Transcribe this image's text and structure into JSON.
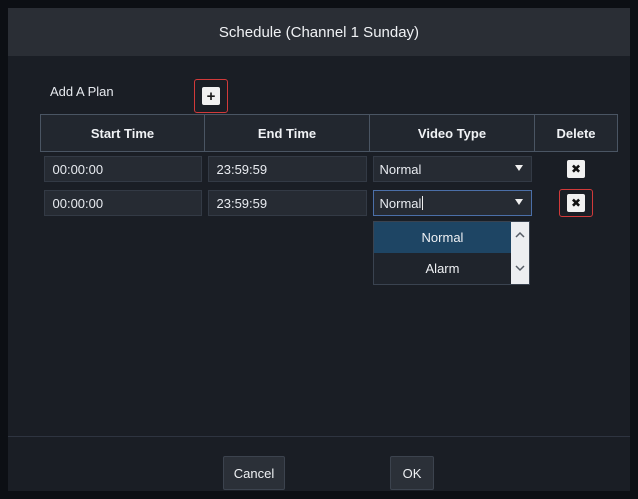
{
  "dialog": {
    "title": "Schedule (Channel 1 Sunday)",
    "add_plan_label": "Add A Plan",
    "add_icon": "plus-icon"
  },
  "table": {
    "headers": [
      "Start Time",
      "End Time",
      "Video Type",
      "Delete"
    ],
    "rows": [
      {
        "start": "00:00:00",
        "end": "23:59:59",
        "video_type": "Normal"
      },
      {
        "start": "00:00:00",
        "end": "23:59:59",
        "video_type": "Normal"
      }
    ],
    "delete_icon": "close-icon"
  },
  "dropdown": {
    "options": [
      "Normal",
      "Alarm"
    ],
    "selected": "Normal"
  },
  "footer": {
    "cancel_label": "Cancel",
    "ok_label": "OK"
  },
  "colors": {
    "highlight_outline": "#d23a3a",
    "selected_option": "#1e4564",
    "title_bar": "#2a2e35"
  }
}
